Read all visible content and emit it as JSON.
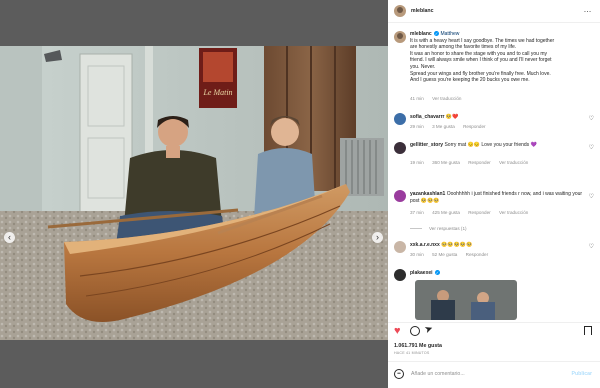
{
  "post": {
    "author": "mleblanc",
    "caption": {
      "author": "mleblanc",
      "mention": "Matthew",
      "lines": [
        "It is with a heavy heart I say goodbye. The times we had together",
        "are honestly among the favorite times of my life.",
        "It was an honor to share the stage with you and to call you my",
        "friend. I will always smile when I think of you and I'll never forget",
        "you. Never.",
        "Spread your wings and fly brother you're finally free. Much love.",
        "And I guess you're keeping the 20 bucks you owe me."
      ],
      "time": "41 min",
      "translate": "Ver traducción"
    },
    "poster_text": "Le Matin",
    "likes": "1.061.791 Me gusta",
    "posted_ago": "HACE 41 MINUTOS",
    "add_comment_placeholder": "Añade un comentario...",
    "publish_label": "Publicar"
  },
  "comments": [
    {
      "user": "sofia_chavarrr",
      "text": "🥺❤️",
      "meta": [
        "29 min",
        "3 Me gusta",
        "Responder"
      ]
    },
    {
      "user": "gellitter_story",
      "text": "Sorry mat 😔😔 Love you your friends 💜",
      "meta": [
        "19 min",
        "360 Me gusta",
        "Responder",
        "Ver traducción"
      ]
    },
    {
      "user": "yazankashlan1",
      "text": "Ooohhhhh i just finished friends r now, and i was waiting your post 🥺🥺🥺",
      "meta": [
        "37 min",
        "425 Me gusta",
        "Responder",
        "Ver traducción"
      ],
      "replies": "Ver respuestas (1)"
    },
    {
      "user": "xxk.a.r.e.nxx",
      "text": "🥺🥺🥺🥺🥺",
      "meta": [
        "30 min",
        "52 Me gusta",
        "Responder"
      ]
    },
    {
      "user": "plakaexei",
      "text": ""
    }
  ],
  "icons": {
    "more": "more-icon",
    "heart": "heart-icon",
    "comment": "comment-icon",
    "share": "share-icon",
    "bookmark": "bookmark-icon",
    "emoji": "emoji-icon"
  },
  "colors": {
    "like_red": "#ed4956",
    "verified_blue": "#0095f6",
    "publish_blue": "#b2dffc"
  }
}
